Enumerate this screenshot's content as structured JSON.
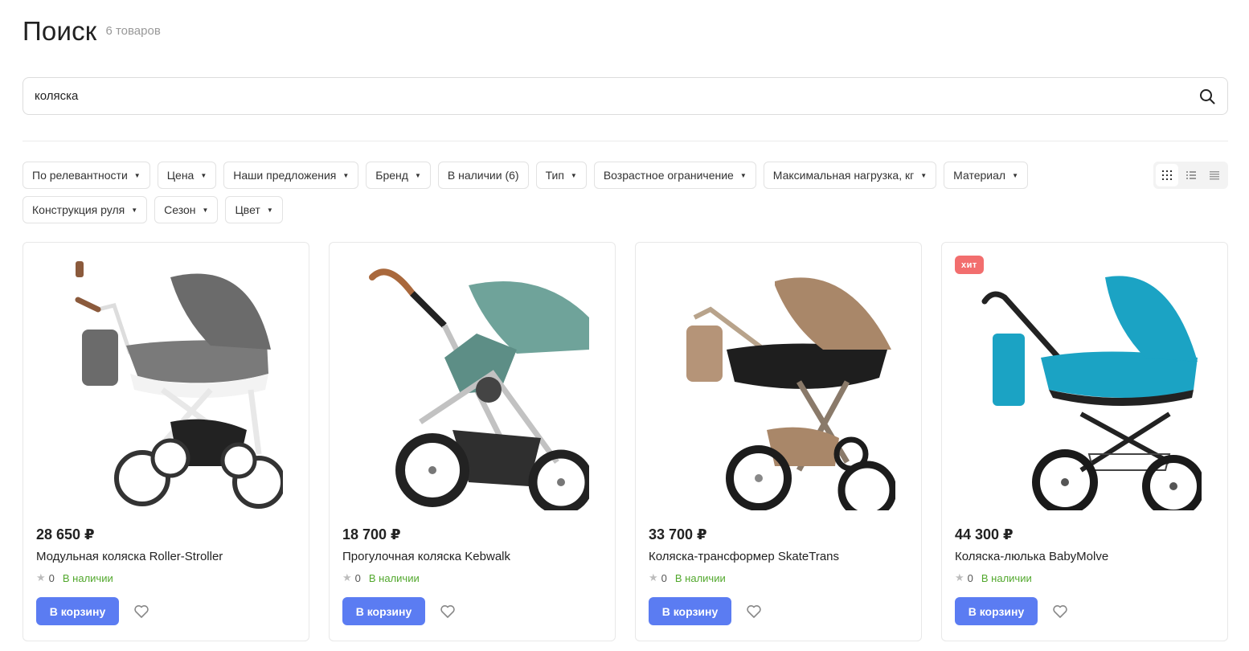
{
  "header": {
    "title": "Поиск",
    "count": "6 товаров"
  },
  "search": {
    "value": "коляска",
    "icon": "search-icon"
  },
  "filters": [
    {
      "label": "По релевантности"
    },
    {
      "label": "Цена"
    },
    {
      "label": "Наши предложения"
    },
    {
      "label": "Бренд"
    },
    {
      "label": "В наличии (6)"
    },
    {
      "label": "Тип"
    },
    {
      "label": "Возрастное ограничение"
    },
    {
      "label": "Максимальная нагрузка, кг"
    },
    {
      "label": "Материал"
    },
    {
      "label": "Конструкция руля"
    },
    {
      "label": "Сезон"
    },
    {
      "label": "Цвет"
    }
  ],
  "view_modes": [
    "grid-view-icon",
    "list-view-icon",
    "compact-list-icon"
  ],
  "products": [
    {
      "price": "28 650 ₽",
      "name": "Модульная коляска Roller-Stroller",
      "rating": "0",
      "stock": "В наличии",
      "cart_label": "В корзину",
      "badge": "",
      "color": "#6b6b6b"
    },
    {
      "price": "18 700 ₽",
      "name": "Прогулочная коляска Kebwalk",
      "rating": "0",
      "stock": "В наличии",
      "cart_label": "В корзину",
      "badge": "",
      "color": "#6fa39a"
    },
    {
      "price": "33 700 ₽",
      "name": "Коляска-трансформер SkateTrans",
      "rating": "0",
      "stock": "В наличии",
      "cart_label": "В корзину",
      "badge": "",
      "color": "#a98769"
    },
    {
      "price": "44 300 ₽",
      "name": "Коляска-люлька BabyMolve",
      "rating": "0",
      "stock": "В наличии",
      "cart_label": "В корзину",
      "badge": "хит",
      "color": "#1ba3c4"
    }
  ],
  "colors": {
    "accent": "#5b7cf2",
    "stock": "#52a82d",
    "badge": "#f26e6e"
  }
}
